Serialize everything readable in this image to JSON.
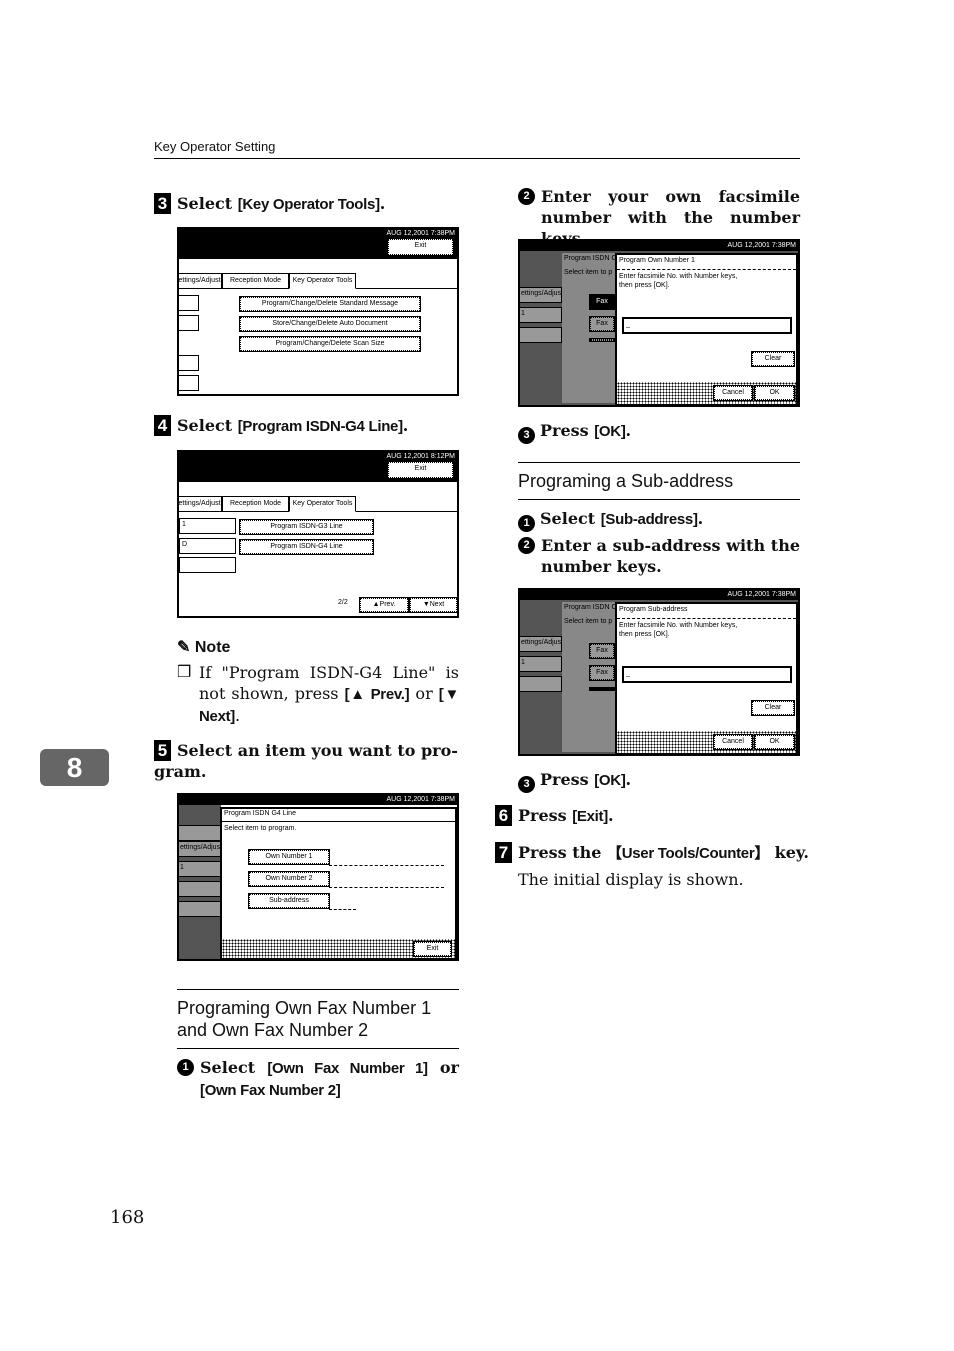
{
  "header": {
    "title": "Key Operator Setting"
  },
  "chapter_tab": "8",
  "page_number": "168",
  "screen_common": {
    "date": "AUG 12,2001 7:38PM",
    "date2": "AUG 12,2001 8:12PM",
    "exit": "Exit",
    "tabs": [
      "ettings/Adjust",
      "Reception Mode",
      "Key Operator Tools"
    ]
  },
  "step3": {
    "num": "3",
    "pre": "Select ",
    "key": "[Key Operator Tools]",
    "post": ".",
    "screen": {
      "items": [
        "Program/Change/Delete Standard Message",
        "Store/Change/Delete Auto Document",
        "Program/Change/Delete Scan Size"
      ]
    }
  },
  "step4": {
    "num": "4",
    "pre": "Select ",
    "key": "[Program ISDN-G4 Line]",
    "post": ".",
    "screen": {
      "left_boxes": [
        "1",
        "D",
        ""
      ],
      "items": [
        "Program ISDN-G3 Line",
        "Program ISDN-G4 Line"
      ],
      "page": "2/2",
      "prev": "▲Prev.",
      "next": "▼Next"
    }
  },
  "note": {
    "title": "Note",
    "t1": "If \"Program ISDN-G4 Line\" is not shown, press ",
    "k1": "[▲ Prev.]",
    "t2": " or ",
    "k2": "[▼ Next]",
    "t3": "."
  },
  "step5": {
    "num": "5",
    "text": "Select an item you want to pro-gram.",
    "screen": {
      "title": "Program ISDN G4 Line",
      "prompt": "Select item to program.",
      "items": [
        "Own Number 1",
        "Own Number 2",
        "Sub-address"
      ],
      "exit": "Exit",
      "side_left": "ettings/Adjus",
      "side_1": "1"
    }
  },
  "section1": {
    "title": "Programing Own Fax Number 1 and Own Fax Number 2",
    "sub1": {
      "num": "1",
      "pre": "Select ",
      "k1": "[Own Fax Number 1]",
      "mid": " or ",
      "k2": "[Own Fax Number 2]"
    },
    "sub2": {
      "num": "2",
      "text": "Enter your own facsimile number with the number keys.",
      "screen": {
        "bg_title": "Program ISDN C",
        "bg_prompt": "Select item to p",
        "bg_btn": "Fax",
        "title": "Program Own Number 1",
        "prompt1": "Enter facsimile No. with Number keys,",
        "prompt2": "then press [OK].",
        "input": "_",
        "clear": "Clear",
        "cancel": "Cancel",
        "ok": "OK"
      }
    },
    "sub3": {
      "num": "3",
      "pre": "Press ",
      "key": "[OK]",
      "post": "."
    }
  },
  "section2": {
    "title": "Programing a Sub-address",
    "sub1": {
      "num": "1",
      "pre": "Select ",
      "key": "[Sub-address]",
      "post": "."
    },
    "sub2": {
      "num": "2",
      "text": "Enter a sub-address with the number keys.",
      "screen": {
        "title": "Program Sub-address",
        "prompt1": "Enter facsimile No. with Number keys,",
        "prompt2": "then press [OK].",
        "input": "_",
        "clear": "Clear",
        "cancel": "Cancel",
        "ok": "OK"
      }
    },
    "sub3": {
      "num": "3",
      "pre": "Press ",
      "key": "[OK]",
      "post": "."
    }
  },
  "step6": {
    "num": "6",
    "pre": "Press ",
    "key": "[Exit]",
    "post": "."
  },
  "step7": {
    "num": "7",
    "pre": "Press the ",
    "key": "【User Tools/Counter】",
    "post": " key.",
    "result": "The initial display is shown."
  }
}
